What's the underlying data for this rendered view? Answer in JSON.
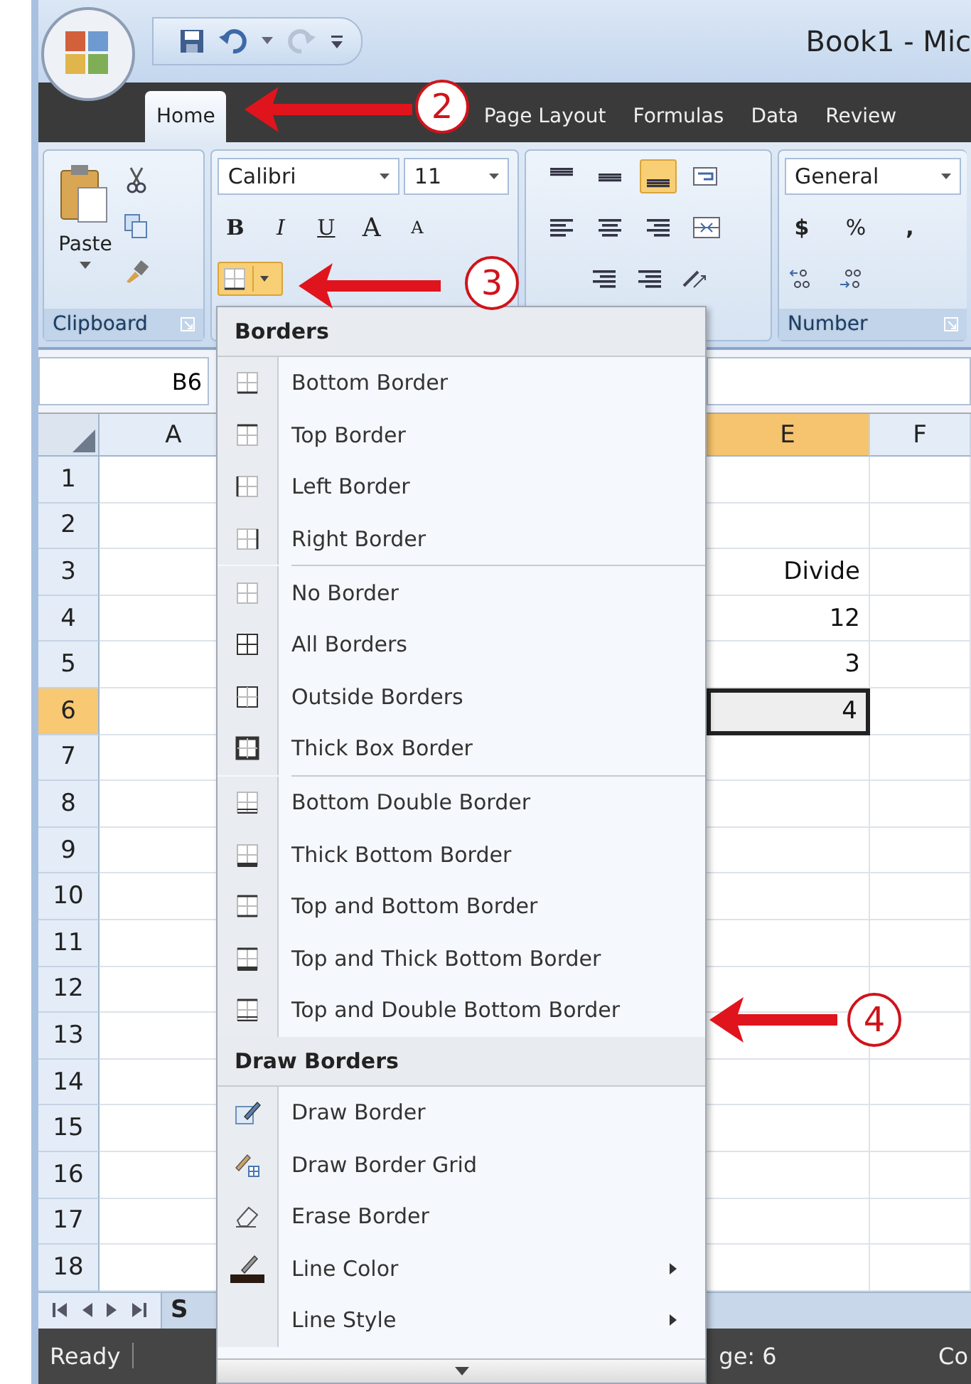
{
  "window": {
    "title": "Book1 - Mic"
  },
  "ribbon_tabs": [
    {
      "label": "Home",
      "selected": true
    },
    {
      "label": "Page Layout",
      "selected": false
    },
    {
      "label": "Formulas",
      "selected": false
    },
    {
      "label": "Data",
      "selected": false
    },
    {
      "label": "Review",
      "selected": false
    }
  ],
  "clipboard": {
    "paste_label": "Paste",
    "group_label": "Clipboard"
  },
  "font": {
    "name": "Calibri",
    "size": "11",
    "bold": "B",
    "italic": "I",
    "underline": "U",
    "grow": "A",
    "shrink": "A"
  },
  "alignment": {
    "vertical": [
      {
        "selected": false
      },
      {
        "selected": false
      },
      {
        "selected": true
      }
    ]
  },
  "number": {
    "format": "General",
    "currency": "$",
    "percent": "%",
    "comma": ",",
    "group_label": "Number"
  },
  "name_box": "B6",
  "columns": [
    {
      "label": "A",
      "selected": false
    },
    {
      "label": "E",
      "selected": true
    },
    {
      "label": "F",
      "selected": false
    }
  ],
  "rows": [
    {
      "label": "1",
      "selected": false
    },
    {
      "label": "2",
      "selected": false
    },
    {
      "label": "3",
      "selected": false,
      "value": "Divide"
    },
    {
      "label": "4",
      "selected": false,
      "value": "12"
    },
    {
      "label": "5",
      "selected": false,
      "value": "3"
    },
    {
      "label": "6",
      "selected": true,
      "value": "4"
    },
    {
      "label": "7",
      "selected": false
    },
    {
      "label": "8",
      "selected": false
    },
    {
      "label": "9",
      "selected": false
    },
    {
      "label": "10",
      "selected": false
    },
    {
      "label": "11",
      "selected": false
    },
    {
      "label": "12",
      "selected": false
    },
    {
      "label": "13",
      "selected": false
    },
    {
      "label": "14",
      "selected": false
    },
    {
      "label": "15",
      "selected": false
    },
    {
      "label": "16",
      "selected": false
    },
    {
      "label": "17",
      "selected": false
    },
    {
      "label": "18",
      "selected": false
    }
  ],
  "sheet_tab": "S",
  "status_bar": {
    "ready": "Ready",
    "page": "ge: 6",
    "right": "Co"
  },
  "borders_menu": [
    {
      "kind": "header",
      "label": "Borders"
    },
    {
      "kind": "item",
      "label": "Bottom Border"
    },
    {
      "kind": "item",
      "label": "Top Border"
    },
    {
      "kind": "item",
      "label": "Left Border"
    },
    {
      "kind": "item",
      "label": "Right Border"
    },
    {
      "kind": "separator"
    },
    {
      "kind": "item",
      "label": "No Border"
    },
    {
      "kind": "item",
      "label": "All Borders"
    },
    {
      "kind": "item",
      "label": "Outside Borders"
    },
    {
      "kind": "item",
      "label": "Thick Box Border"
    },
    {
      "kind": "separator"
    },
    {
      "kind": "item",
      "label": "Bottom Double Border"
    },
    {
      "kind": "item",
      "label": "Thick Bottom Border"
    },
    {
      "kind": "item",
      "label": "Top and Bottom Border"
    },
    {
      "kind": "item",
      "label": "Top and Thick Bottom Border"
    },
    {
      "kind": "item",
      "label": "Top and Double Bottom Border"
    },
    {
      "kind": "header",
      "label": "Draw Borders"
    },
    {
      "kind": "item",
      "label": "Draw Border"
    },
    {
      "kind": "item",
      "label": "Draw Border Grid"
    },
    {
      "kind": "item",
      "label": "Erase Border"
    },
    {
      "kind": "item",
      "label": "Line Color",
      "has_submenu": true
    },
    {
      "kind": "item",
      "label": "Line Style",
      "has_submenu": true
    }
  ],
  "callouts": [
    {
      "number": "2"
    },
    {
      "number": "3"
    },
    {
      "number": "4"
    }
  ]
}
